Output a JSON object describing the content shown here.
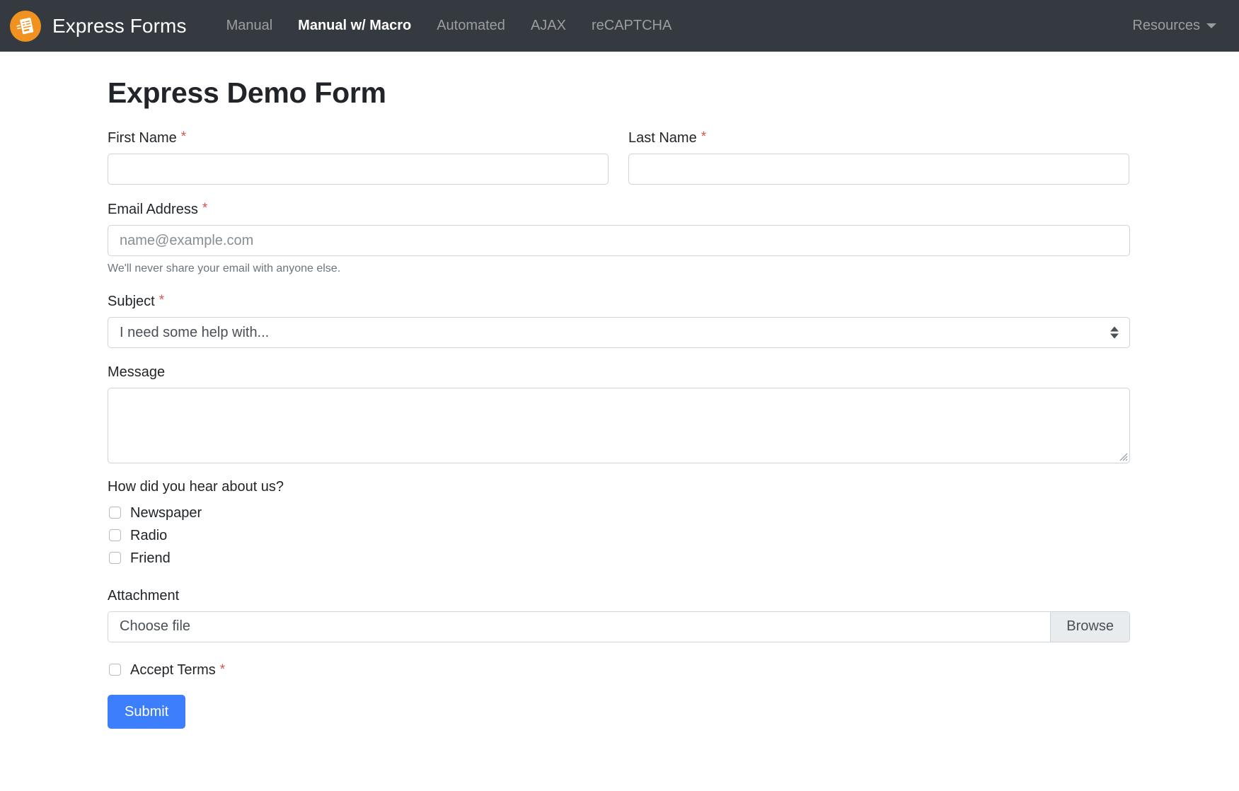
{
  "navbar": {
    "brand": {
      "text": "Express Forms",
      "logo_icon": "form-document-icon",
      "logo_color": "#f0921f"
    },
    "links": [
      {
        "label": "Manual",
        "active": false
      },
      {
        "label": "Manual w/ Macro",
        "active": true
      },
      {
        "label": "Automated",
        "active": false
      },
      {
        "label": "AJAX",
        "active": false
      },
      {
        "label": "reCAPTCHA",
        "active": false
      }
    ],
    "dropdown": {
      "label": "Resources",
      "icon": "caret-down-icon"
    },
    "background_color": "#343a40"
  },
  "page": {
    "title": "Express Demo Form",
    "required_marker": "*"
  },
  "fields": {
    "first_name": {
      "label": "First Name",
      "required": true,
      "value": "",
      "placeholder": ""
    },
    "last_name": {
      "label": "Last Name",
      "required": true,
      "value": "",
      "placeholder": ""
    },
    "email": {
      "label": "Email Address",
      "required": true,
      "value": "",
      "placeholder": "name@example.com",
      "help": "We'll never share your email with anyone else."
    },
    "subject": {
      "label": "Subject",
      "required": true,
      "selected": "I need some help with...",
      "options": [
        "I need some help with..."
      ],
      "icon": "select-updown-icon"
    },
    "message": {
      "label": "Message",
      "required": false,
      "value": "",
      "placeholder": "",
      "resize_icon": "resize-grip-icon"
    },
    "hear_about": {
      "label": "How did you hear about us?",
      "options": [
        {
          "label": "Newspaper",
          "checked": false
        },
        {
          "label": "Radio",
          "checked": false
        },
        {
          "label": "Friend",
          "checked": false
        }
      ]
    },
    "attachment": {
      "label": "Attachment",
      "required": false,
      "placeholder": "Choose file",
      "browse_label": "Browse"
    },
    "accept_terms": {
      "label": "Accept Terms",
      "required": true,
      "checked": false
    }
  },
  "actions": {
    "submit_label": "Submit",
    "submit_color": "#3d7efd"
  }
}
